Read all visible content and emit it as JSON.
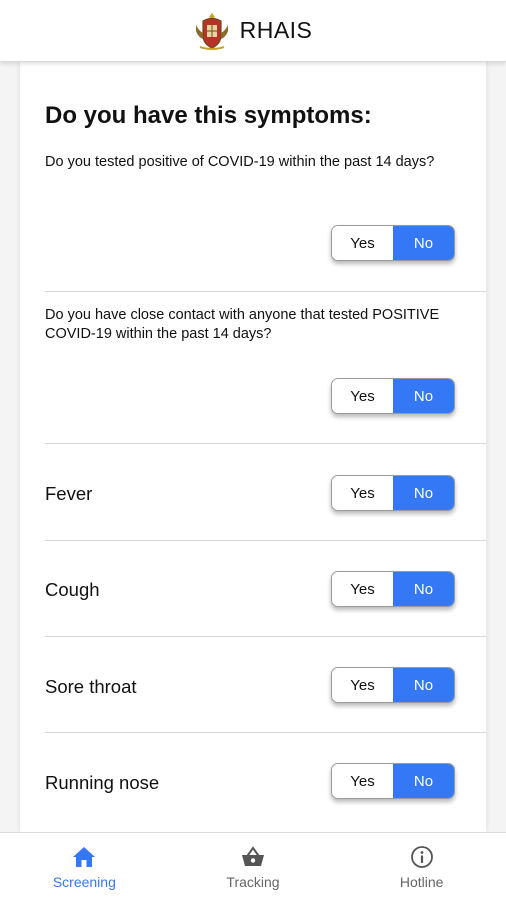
{
  "header": {
    "title": "RHAIS"
  },
  "page": {
    "heading": "Do you have this symptoms:"
  },
  "questions": [
    {
      "text": "Do you tested positive of COVID-19 within the past 14 days?",
      "yes_label": "Yes",
      "no_label": "No",
      "selected": "No"
    },
    {
      "text": "Do you have close contact with anyone that tested POSITIVE COVID-19 within the past 14 days?",
      "yes_label": "Yes",
      "no_label": "No",
      "selected": "No"
    }
  ],
  "symptoms": [
    {
      "label": "Fever",
      "yes_label": "Yes",
      "no_label": "No",
      "selected": "No"
    },
    {
      "label": "Cough",
      "yes_label": "Yes",
      "no_label": "No",
      "selected": "No"
    },
    {
      "label": "Sore throat",
      "yes_label": "Yes",
      "no_label": "No",
      "selected": "No"
    },
    {
      "label": "Running nose",
      "yes_label": "Yes",
      "no_label": "No",
      "selected": "No"
    }
  ],
  "nav": {
    "items": [
      {
        "label": "Screening",
        "icon": "home-icon",
        "active": true
      },
      {
        "label": "Tracking",
        "icon": "basket-icon",
        "active": false
      },
      {
        "label": "Hotline",
        "icon": "info-icon",
        "active": false
      }
    ]
  },
  "colors": {
    "accent": "#3478f6",
    "inactive": "#666666"
  }
}
